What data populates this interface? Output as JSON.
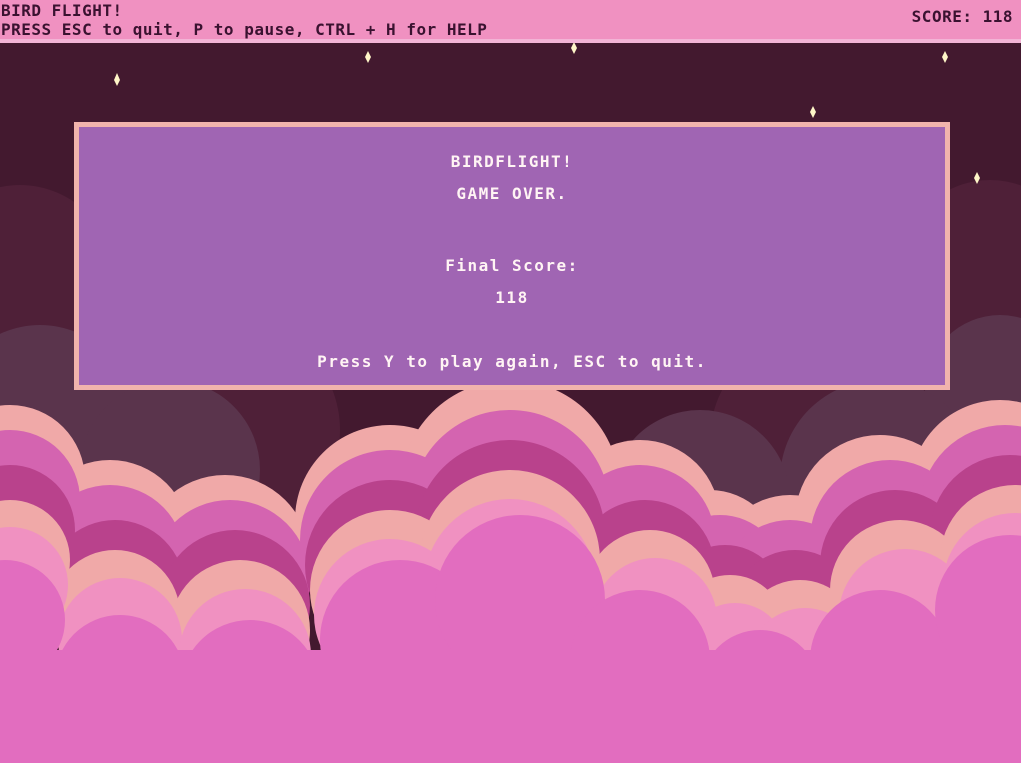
{
  "hud": {
    "title": "BIRD FLIGHT!",
    "help": "PRESS ESC to quit, P to pause, CTRL + H for HELP",
    "score_label": "SCORE:",
    "score_value": "118",
    "score_text": "SCORE: 118"
  },
  "dialog": {
    "title": "BIRDFLIGHT!",
    "status": "GAME OVER.",
    "final_score_label": "Final Score:",
    "final_score_value": "118",
    "prompt": "Press Y to play again, ESC to quit."
  },
  "colors": {
    "sky": "#43192f",
    "hud_bar": "#f091c1",
    "dialog_bg": "#a065b3",
    "dialog_border": "#f1b4ad",
    "cloud_front": "#e26dbf",
    "cloud_pink": "#f091c1",
    "cloud_peach": "#f0a9a8",
    "cloud_magenta": "#b9428c",
    "cloud_mid": "#d464b0",
    "cloud_back": "#5a344c",
    "star": "#fff6c8"
  },
  "icons": {
    "star": "star-icon"
  }
}
